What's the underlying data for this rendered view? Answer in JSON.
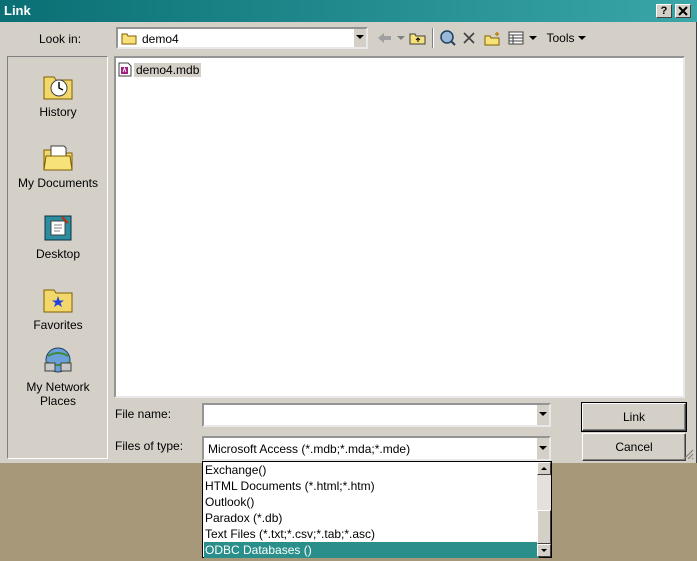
{
  "window": {
    "title": "Link",
    "help_label": "?",
    "close_label": "x"
  },
  "look_in": {
    "label": "Look in:",
    "value": "demo4"
  },
  "toolbar": {
    "tools_label": "Tools"
  },
  "places": [
    {
      "label": "History"
    },
    {
      "label": "My Documents"
    },
    {
      "label": "Desktop"
    },
    {
      "label": "Favorites"
    },
    {
      "label": "My Network Places"
    }
  ],
  "files": [
    {
      "name": "demo4.mdb"
    }
  ],
  "file_name": {
    "label": "File name:",
    "value": ""
  },
  "files_of_type": {
    "label": "Files of type:",
    "value": "Microsoft Access (*.mdb;*.mda;*.mde)",
    "options": [
      "Exchange()",
      "HTML Documents (*.html;*.htm)",
      "Outlook()",
      "Paradox (*.db)",
      "Text Files (*.txt;*.csv;*.tab;*.asc)",
      "ODBC Databases ()"
    ],
    "selected_index": 5
  },
  "buttons": {
    "link": "Link",
    "cancel": "Cancel"
  },
  "colors": {
    "title_bar": "#0a6f74",
    "selection": "#2a8e8a",
    "desktop": "#a8987a"
  }
}
